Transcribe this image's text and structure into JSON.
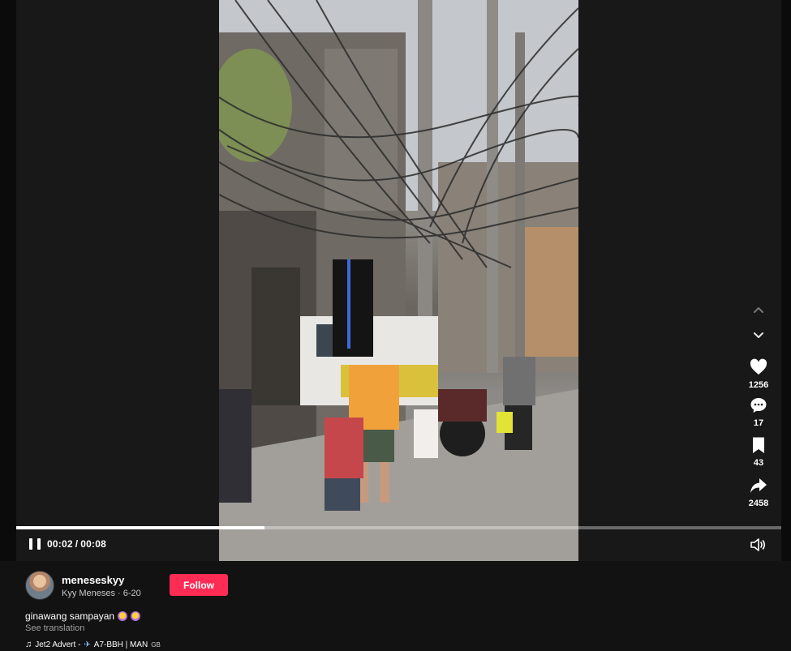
{
  "player": {
    "elapsed": "00:02",
    "separator": "/",
    "duration": "00:08",
    "progress_fraction": 0.324
  },
  "actions": {
    "likes": "1256",
    "comments": "17",
    "saves": "43",
    "shares": "2458"
  },
  "author": {
    "username": "meneseskyy",
    "display_name": "Kyy  Meneses",
    "date_sep": "·",
    "date": "6-20"
  },
  "follow_label": "Follow",
  "caption": {
    "text": "ginawang sampayan"
  },
  "see_translation": "See translation",
  "music": {
    "note": "♫",
    "title": "Jet2 Advert -",
    "plane_icon": "✈",
    "artist": "A7-BBH | MAN",
    "suffix": "GB"
  },
  "colors": {
    "follow": "#fe2c55",
    "background": "#121212"
  },
  "icons": [
    "pause-icon",
    "volume-icon",
    "chevron-up-icon",
    "chevron-down-icon",
    "heart-icon",
    "comment-icon",
    "bookmark-icon",
    "share-icon",
    "music-note-icon",
    "airplane-icon"
  ]
}
